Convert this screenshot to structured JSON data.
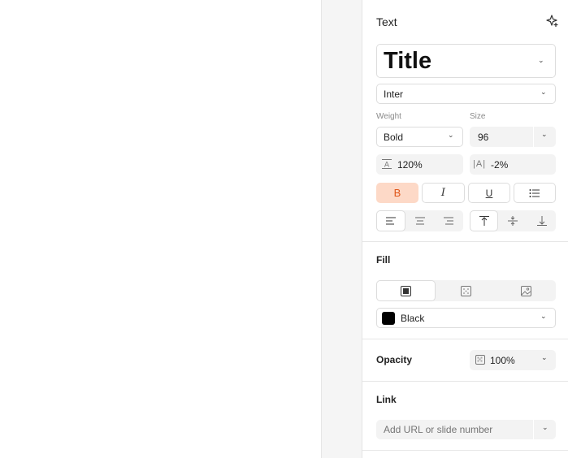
{
  "text_section": {
    "title": "Text",
    "style_preset": "Title",
    "font_family": "Inter",
    "weight_label": "Weight",
    "weight_value": "Bold",
    "size_label": "Size",
    "size_value": "96",
    "line_height": "120%",
    "letter_spacing": "-2%",
    "letter_spacing_prefix": "|A|",
    "style_buttons": [
      {
        "label": "B",
        "active": true
      },
      {
        "label": "I",
        "active": false
      },
      {
        "label": "U",
        "active": false
      },
      {
        "label": "list",
        "active": false
      }
    ],
    "align_horizontal": [
      "left",
      "center",
      "right"
    ],
    "align_horizontal_selected": "left",
    "align_vertical": [
      "top",
      "middle",
      "bottom"
    ],
    "align_vertical_selected": "top"
  },
  "fill_section": {
    "title": "Fill",
    "fill_types": [
      "solid",
      "pattern",
      "image"
    ],
    "fill_type_selected": "solid",
    "color_name": "Black",
    "color_hex": "#000000"
  },
  "opacity_section": {
    "title": "Opacity",
    "value": "100%"
  },
  "link_section": {
    "title": "Link",
    "placeholder": "Add URL or slide number"
  },
  "colors": {
    "accent_bg": "#fdd9c7",
    "accent_fg": "#e0581c"
  }
}
